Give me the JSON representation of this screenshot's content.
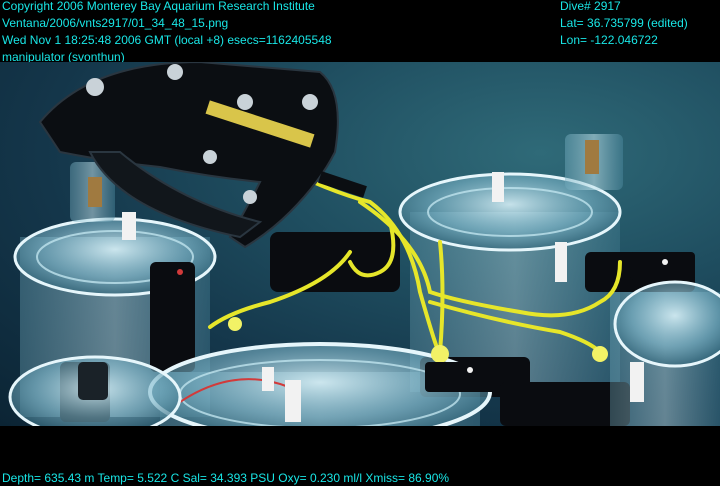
{
  "overlay": {
    "top_left": [
      "Copyright 2006 Monterey Bay Aquarium Research Institute",
      "Ventana/2006/vnts2917/01_34_48_15.png",
      "Wed Nov  1 18:25:48 2006 GMT (local +8)  esecs=1162405548",
      "manipulator (svonthun)"
    ],
    "top_right": [
      "Dive# 2917",
      "Lat= 36.735799 (edited)",
      "Lon= -122.046722"
    ],
    "bottom": "Depth= 635.43 m  Temp= 5.522 C  Sal= 34.393 PSU  Oxy= 0.230 ml/l  Xmiss= 86.90%"
  },
  "scene": {
    "description_label": "ROV manipulator arm holding yellow rope among clear sediment core chambers",
    "colors": {
      "text": "#19e6e6",
      "water": "#1f4e60",
      "rope": "#e6e62a",
      "arm": "#0c0f14",
      "plastic": "#a9d6e6"
    }
  }
}
